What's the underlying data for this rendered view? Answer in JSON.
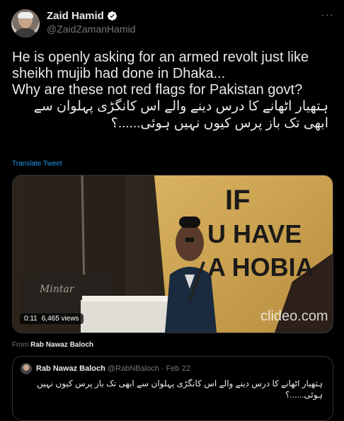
{
  "author": {
    "display_name": "Zaid Hamid",
    "handle": "@ZaidZamanHamid"
  },
  "more_icon": "···",
  "tweet": {
    "line1": "He is openly asking for an armed revolt just like sheikh mujib had done in Dhaka...",
    "line2": "Why are these not red flags for Pakistan govt?",
    "urdu": "ہتھیار اٹھانے کا درس دینے والے اس کانگڑی پہلوان سے ابھی تک باز پرس کیوں نہیں ہوئی......؟"
  },
  "translate_label": "Translate Tweet",
  "media": {
    "time": "0:11",
    "views": "6,465 views",
    "banner_word1": "IF",
    "banner_word2": "U HAVE",
    "banner_word3": "A  HOBIA",
    "watermark": "clideo.com",
    "podium_text": "Mintar"
  },
  "from": {
    "prefix": "From",
    "source": "Rab Nawaz Baloch"
  },
  "quote": {
    "name": "Rab Nawaz Baloch",
    "handle": "@RabNBaloch",
    "date": "· Feb 22",
    "text": "ہتھیار اٹھانے کا درس دینے والے اس کانگڑی پہلوان سے ابھی تک باز پرس کیوں نہیں ہوئی......؟"
  }
}
